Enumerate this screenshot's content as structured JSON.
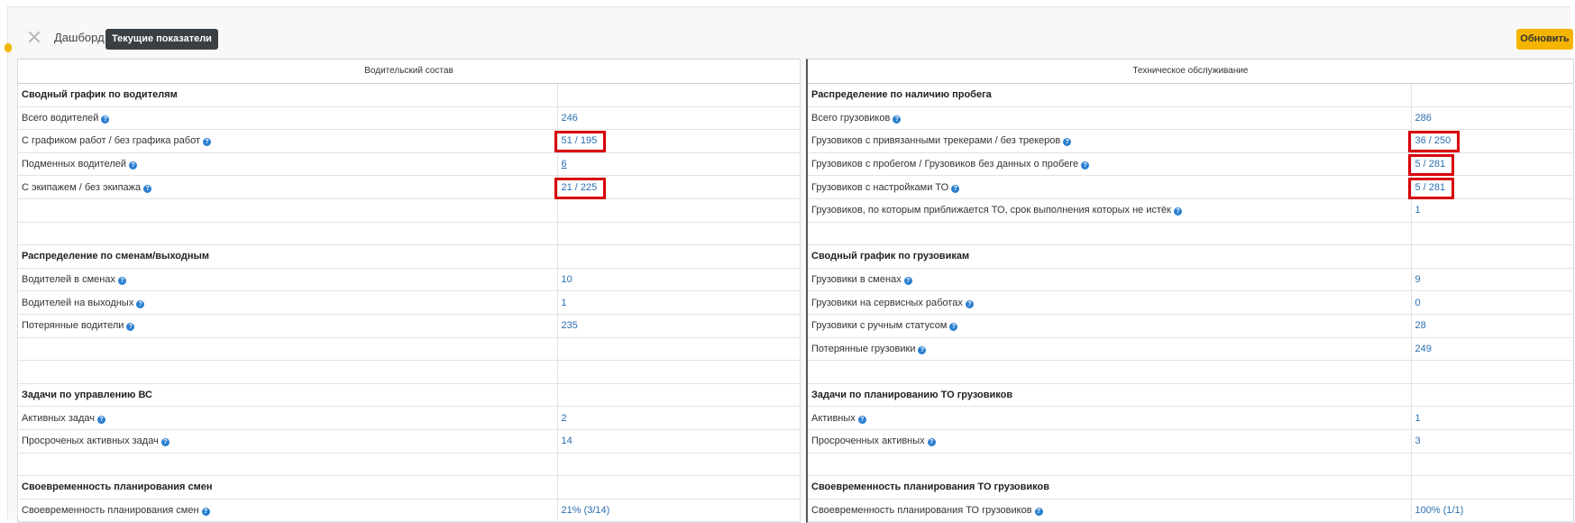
{
  "header": {
    "breadcrumb": "Дашборд",
    "current_chip": "Текущие показатели",
    "refresh_label": "Обновить"
  },
  "colors": {
    "accent_button": "#f4b400",
    "link": "#2a6eb0",
    "highlight_box": "#d8000c",
    "chip_bg": "#3a3f44"
  },
  "left": {
    "title": "Водительский состав",
    "rows": [
      {
        "type": "section",
        "label": "Сводный график по водителям",
        "value": ""
      },
      {
        "type": "item",
        "label": "Всего водителей",
        "value": "246",
        "help": true
      },
      {
        "type": "item",
        "label": "С графиком работ / без графика работ",
        "value": "51 / 195",
        "help": true,
        "highlight": true
      },
      {
        "type": "item",
        "label": "Подменных водителей",
        "value": "6",
        "help": true,
        "underline": true
      },
      {
        "type": "item",
        "label": "С экипажем / без экипажа",
        "value": "21 / 225",
        "help": true,
        "highlight": true
      },
      {
        "type": "empty",
        "label": "",
        "value": ""
      },
      {
        "type": "empty",
        "label": "",
        "value": ""
      },
      {
        "type": "section",
        "label": "Распределение по сменам/выходным",
        "value": ""
      },
      {
        "type": "item",
        "label": "Водителей в сменах",
        "value": "10",
        "help": true
      },
      {
        "type": "item",
        "label": "Водителей на выходных",
        "value": "1",
        "help": true
      },
      {
        "type": "item",
        "label": "Потерянные водители",
        "value": "235",
        "help": true
      },
      {
        "type": "empty",
        "label": "",
        "value": ""
      },
      {
        "type": "empty",
        "label": "",
        "value": ""
      },
      {
        "type": "section",
        "label": "Задачи по управлению ВС",
        "value": ""
      },
      {
        "type": "item",
        "label": "Активных задач",
        "value": "2",
        "help": true
      },
      {
        "type": "item",
        "label": "Просроченых активных задач",
        "value": "14",
        "help": true
      },
      {
        "type": "empty",
        "label": "",
        "value": ""
      },
      {
        "type": "section",
        "label": "Своевременность планирования смен",
        "value": ""
      },
      {
        "type": "item",
        "label": "Своевременность планирования смен",
        "value": "21% (3/14)",
        "help": true
      }
    ]
  },
  "right": {
    "title": "Техническое обслуживание",
    "rows": [
      {
        "type": "section",
        "label": "Распределение по наличию пробега",
        "value": ""
      },
      {
        "type": "item",
        "label": "Всего грузовиков",
        "value": "286",
        "help": true
      },
      {
        "type": "item",
        "label": "Грузовиков с привязанными трекерами / без трекеров",
        "value": "36 / 250",
        "help": true,
        "highlight": true
      },
      {
        "type": "item",
        "label": "Грузовиков с пробегом / Грузовиков без данных о пробеге",
        "value": "5 / 281",
        "help": true,
        "highlight": true
      },
      {
        "type": "item",
        "label": "Грузовиков с настройками ТО",
        "value": "5 / 281",
        "help": true,
        "highlight": true
      },
      {
        "type": "item",
        "label": "Грузовиков, по которым приближается ТО, срок выполнения которых не истёк",
        "value": "1",
        "help": true
      },
      {
        "type": "empty",
        "label": "",
        "value": ""
      },
      {
        "type": "section",
        "label": "Сводный график по грузовикам",
        "value": ""
      },
      {
        "type": "item",
        "label": "Грузовики в сменах",
        "value": "9",
        "help": true
      },
      {
        "type": "item",
        "label": "Грузовики на сервисных работах",
        "value": "0",
        "help": true
      },
      {
        "type": "item",
        "label": "Грузовики с ручным статусом",
        "value": "28",
        "help": true
      },
      {
        "type": "item",
        "label": "Потерянные грузовики",
        "value": "249",
        "help": true
      },
      {
        "type": "empty",
        "label": "",
        "value": ""
      },
      {
        "type": "section",
        "label": "Задачи по планированию ТО грузовиков",
        "value": ""
      },
      {
        "type": "item",
        "label": "Активных",
        "value": "1",
        "help": true
      },
      {
        "type": "item",
        "label": "Просроченных активных",
        "value": "3",
        "help": true
      },
      {
        "type": "empty",
        "label": "",
        "value": ""
      },
      {
        "type": "section",
        "label": "Своевременность планирования ТО грузовиков",
        "value": ""
      },
      {
        "type": "item",
        "label": "Своевременность планирования ТО грузовиков",
        "value": "100% (1/1)",
        "help": true
      }
    ]
  }
}
